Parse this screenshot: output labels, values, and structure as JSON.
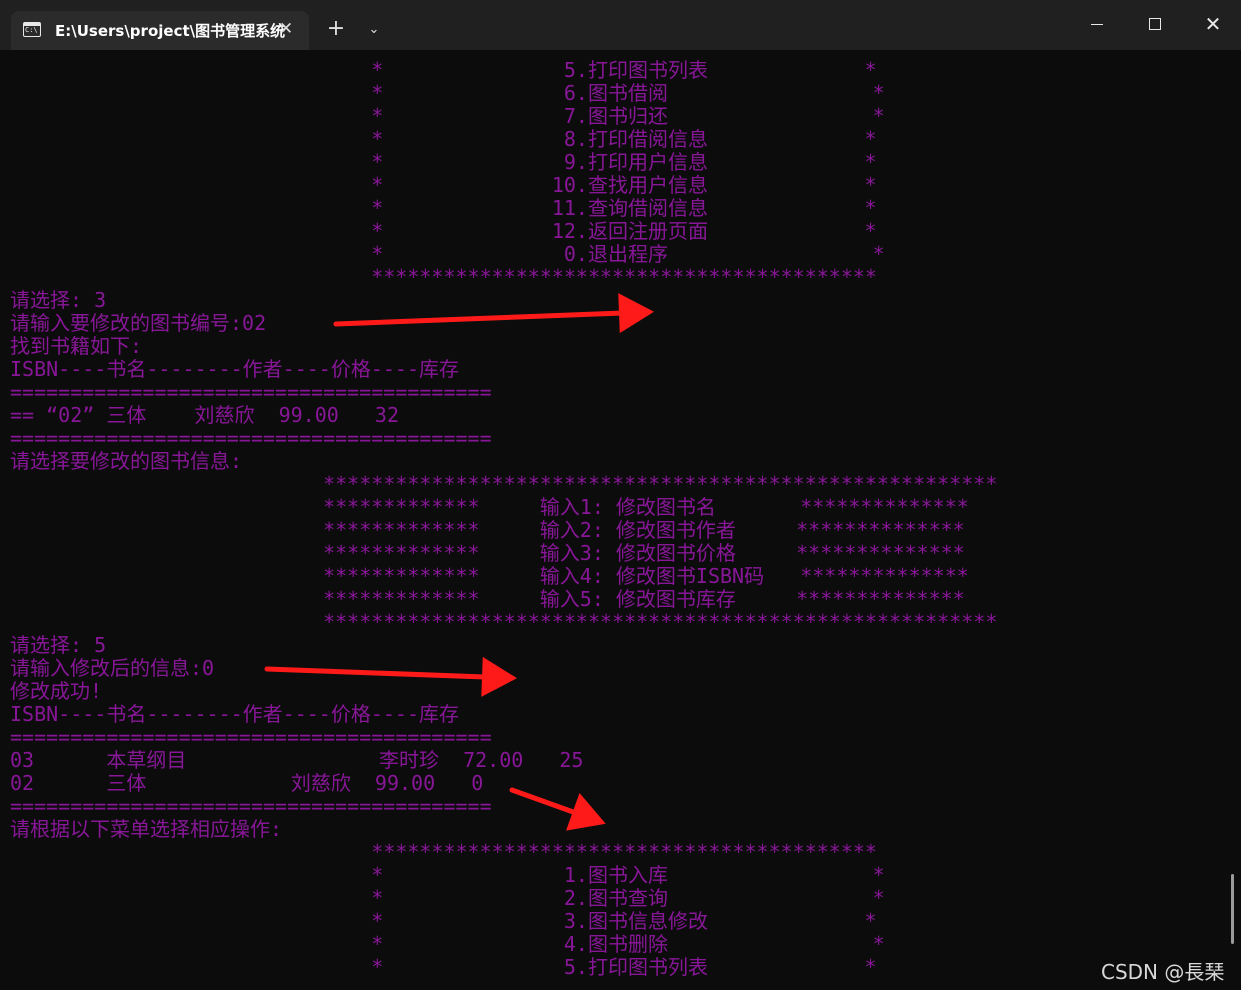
{
  "window": {
    "tab_title": "E:\\Users\\project\\图书管理系统",
    "tab_icon_text": "C:\\",
    "tab_close": "✕",
    "new_tab": "+",
    "dropdown": "⌄",
    "minimize": "",
    "maximize": "",
    "close": "✕"
  },
  "console_lines": [
    "                              *               5.打印图书列表             *",
    "                              *               6.图书借阅                 *",
    "                              *               7.图书归还                 *",
    "                              *               8.打印借阅信息             *",
    "                              *               9.打印用户信息             *",
    "                              *              10.查找用户信息             *",
    "                              *              11.查询借阅信息             *",
    "                              *              12.返回注册页面             *",
    "                              *               0.退出程序                 *",
    "                              ******************************************",
    "请选择: 3",
    "请输入要修改的图书编号:02",
    "找到书籍如下:",
    "ISBN----书名--------作者----价格----库存",
    "========================================",
    "== “02” 三体    刘慈欣  99.00   32",
    "========================================",
    "请选择要修改的图书信息:",
    "                          ********************************************************",
    "                          *************     输入1: 修改图书名       **************",
    "                          *************     输入2: 修改图书作者     **************",
    "                          *************     输入3: 修改图书价格     **************",
    "                          *************     输入4: 修改图书ISBN码   **************",
    "                          *************     输入5: 修改图书库存     **************",
    "                          ********************************************************",
    "请选择: 5",
    "请输入修改后的信息:0",
    "修改成功!",
    "ISBN----书名--------作者----价格----库存",
    "========================================",
    "03      本草纲目                李时珍  72.00   25",
    "02      三体            刘慈欣  99.00   0",
    "========================================",
    "请根据以下菜单选择相应操作:",
    "                              ******************************************",
    "                              *               1.图书入库                 *",
    "                              *               2.图书查询                 *",
    "                              *               3.图书信息修改             *",
    "                              *               4.图书删除                 *",
    "                              *               5.打印图书列表             *"
  ],
  "watermark": "CSDN @長琹",
  "colors": {
    "console_text": "#881798",
    "background": "#0c0c0c",
    "titlebar": "#202020",
    "tab": "#2b2b2b",
    "arrow": "#ff1a1a"
  }
}
